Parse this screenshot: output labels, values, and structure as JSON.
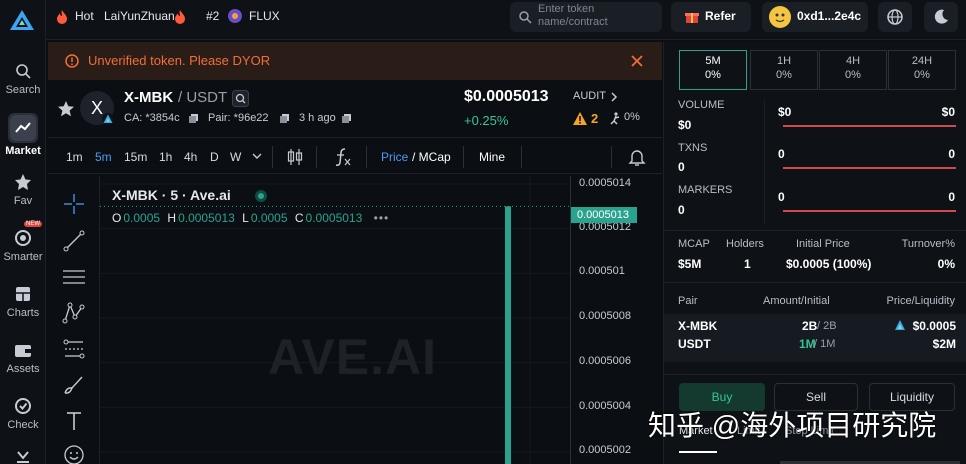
{
  "nav": {
    "items": [
      {
        "label": "Search",
        "icon": "search-icon"
      },
      {
        "label": "Market",
        "icon": "market-icon"
      },
      {
        "label": "Fav",
        "icon": "star-icon"
      },
      {
        "label": "Smarter",
        "icon": "smarter-icon",
        "badge": "NEW"
      },
      {
        "label": "Charts",
        "icon": "charts-icon"
      },
      {
        "label": "Assets",
        "icon": "wallet-icon"
      },
      {
        "label": "Check",
        "icon": "check-icon"
      }
    ]
  },
  "topbar": {
    "hot_label": "Hot",
    "hot_token": "LaiYunZhuan",
    "rank": "#2",
    "rank_token": "FLUX",
    "search_placeholder": "Enter token name/contract",
    "refer_label": "Refer",
    "wallet_address": "0xd1...2e4c"
  },
  "warning": {
    "text": "Unverified token. Please DYOR"
  },
  "token": {
    "symbol": "X-MBK",
    "quote": "/ USDT",
    "avatar_letter": "X",
    "ca": "CA: *3854c",
    "pair": "Pair: *96e22",
    "age": "3 h ago",
    "price": "$0.0005013",
    "change": "+0.25%",
    "audit_label": "AUDIT",
    "audit_count": "2",
    "tax": "0%"
  },
  "chart_toolbar": {
    "timeframes": [
      "1m",
      "5m",
      "15m",
      "1h",
      "4h",
      "D",
      "W"
    ],
    "active_timeframe": "5m",
    "price_label": "Price",
    "mcap_label": "/ MCap",
    "mine_label": "Mine"
  },
  "chart": {
    "title": "X-MBK · 5 · Ave.ai",
    "o_label": "O",
    "o_value": "0.0005",
    "h_label": "H",
    "h_value": "0.0005013",
    "l_label": "L",
    "l_value": "0.0005",
    "c_label": "C",
    "c_value": "0.0005013",
    "watermark": "AVE.AI",
    "last_price": "0.0005013"
  },
  "chart_data": {
    "type": "candlestick",
    "y_ticks": [
      "0.0005014",
      "0.0005012",
      "0.000501",
      "0.0005008",
      "0.0005006",
      "0.0005004",
      "0.0005002"
    ],
    "candles": [
      {
        "open": 0.0005,
        "high": 0.0005013,
        "low": 0.0005,
        "close": 0.0005013
      }
    ],
    "last_price": 0.0005013,
    "up_color": "#2aa38e"
  },
  "stats": {
    "periods": [
      {
        "label": "5M",
        "value": "0%"
      },
      {
        "label": "1H",
        "value": "0%"
      },
      {
        "label": "4H",
        "value": "0%"
      },
      {
        "label": "24H",
        "value": "0%"
      }
    ],
    "volume_label": "VOLUME",
    "volume_value": "$0",
    "volume_buy": "$0",
    "volume_sell": "$0",
    "txns_label": "TXNS",
    "txns_value": "0",
    "txns_buy": "0",
    "txns_sell": "0",
    "makers_label": "MARKERS",
    "makers_value": "0",
    "makers_buy": "0",
    "makers_sell": "0",
    "mcap_label": "MCAP",
    "mcap_value": "$5M",
    "holders_label": "Holders",
    "holders_value": "1",
    "initial_price_label": "Initial Price",
    "initial_price_value": "$0.0005 (100%)",
    "turnover_label": "Turnover%",
    "turnover_value": "0%"
  },
  "liquidity": {
    "pair_label": "Pair",
    "amount_label": "Amount/Initial",
    "price_liq_label": "Price/Liquidity",
    "base": "X-MBK",
    "quote": "USDT",
    "base_amount": "2B",
    "base_initial": "/ 2B",
    "quote_amount": "1M",
    "quote_initial": "/ 1M",
    "price": "$0.0005",
    "liquidity": "$2M"
  },
  "trade": {
    "buy_label": "Buy",
    "sell_label": "Sell",
    "liquidity_label": "Liquidity",
    "tabs": [
      "Market",
      "Limit",
      "Stop Limit"
    ]
  },
  "overlay_watermark": "知乎 @海外项目研究院",
  "colors": {
    "accent": "#2aa38e",
    "warning": "#f06e3a",
    "down": "#d24b4b",
    "link": "#4e9bf0"
  }
}
